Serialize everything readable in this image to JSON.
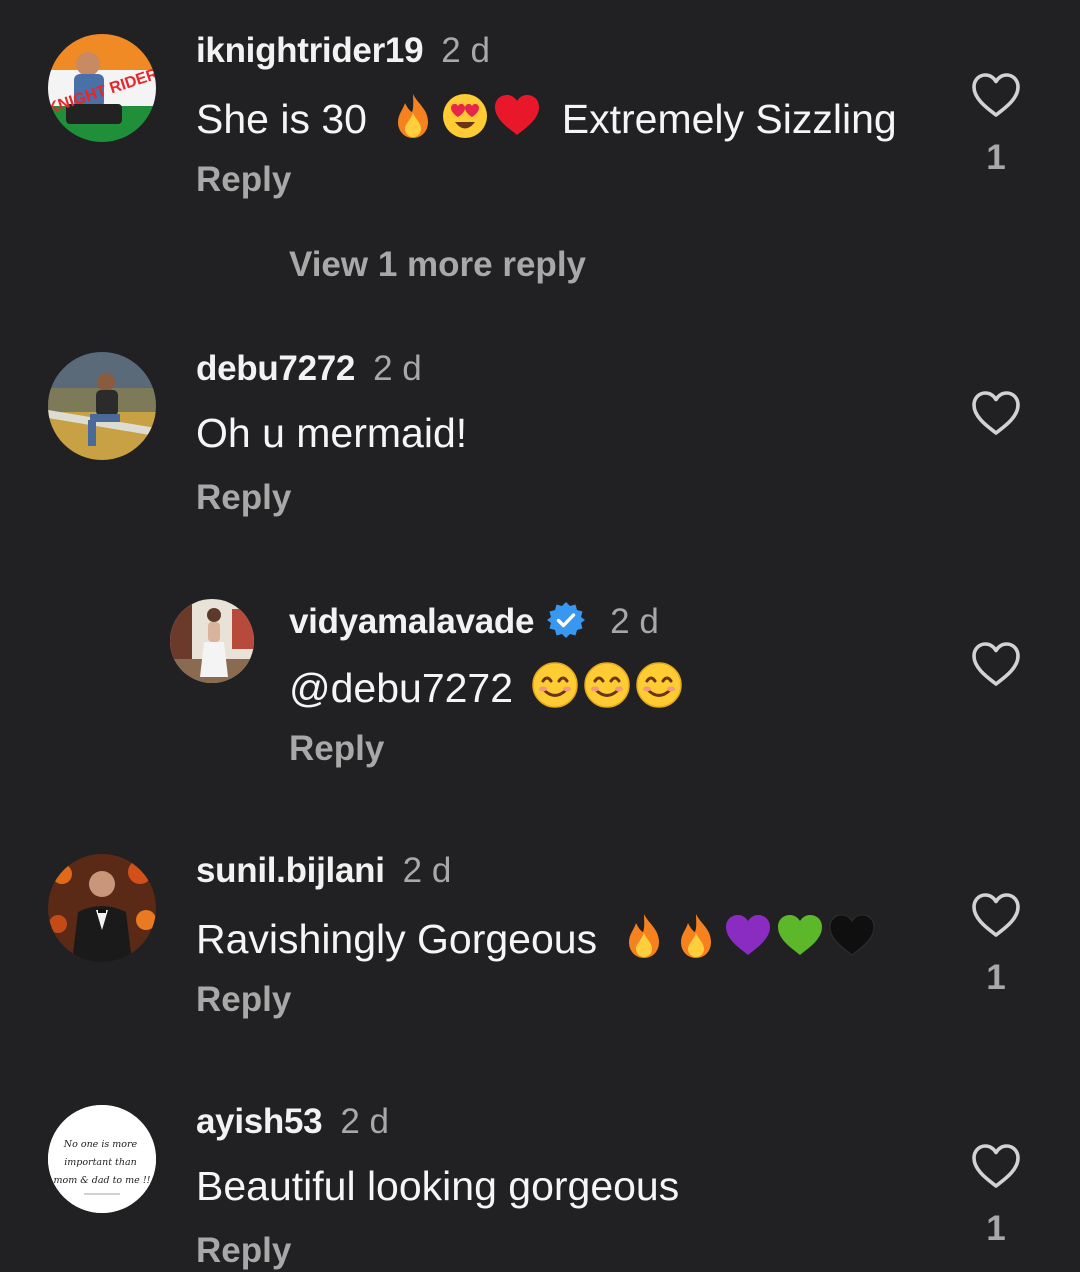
{
  "comments": [
    {
      "username": "iknightrider19",
      "time": "2 d",
      "text_before": "She is 30",
      "emojis": [
        "fire",
        "heart-eyes",
        "red-heart"
      ],
      "text_after": "Extremely Sizzling",
      "reply_label": "Reply",
      "likes": "1",
      "view_more": "View 1 more reply",
      "avatar_text": "KNIGHT RIDER"
    },
    {
      "username": "debu7272",
      "time": "2 d",
      "text": "Oh u mermaid!",
      "reply_label": "Reply"
    },
    {
      "username": "vidyamalavade",
      "verified": true,
      "time": "2 d",
      "text": "@debu7272",
      "emojis": [
        "smiling-face",
        "smiling-face",
        "smiling-face"
      ],
      "reply_label": "Reply"
    },
    {
      "username": "sunil.bijlani",
      "time": "2 d",
      "text": "Ravishingly Gorgeous",
      "emojis": [
        "fire",
        "fire",
        "purple-heart",
        "green-heart",
        "black-heart"
      ],
      "reply_label": "Reply",
      "likes": "1"
    },
    {
      "username": "ayish53",
      "time": "2 d",
      "text": "Beautiful looking gorgeous",
      "reply_label": "Reply",
      "likes": "1",
      "avatar_text": "No one is more important than mom & dad to me !!"
    }
  ],
  "icons": {
    "like": "heart-outline-icon",
    "verified": "verified-badge-icon"
  },
  "colors": {
    "background": "#212123",
    "text": "#f5f5f5",
    "muted": "#a8a8a8",
    "verified": "#3897f0"
  }
}
